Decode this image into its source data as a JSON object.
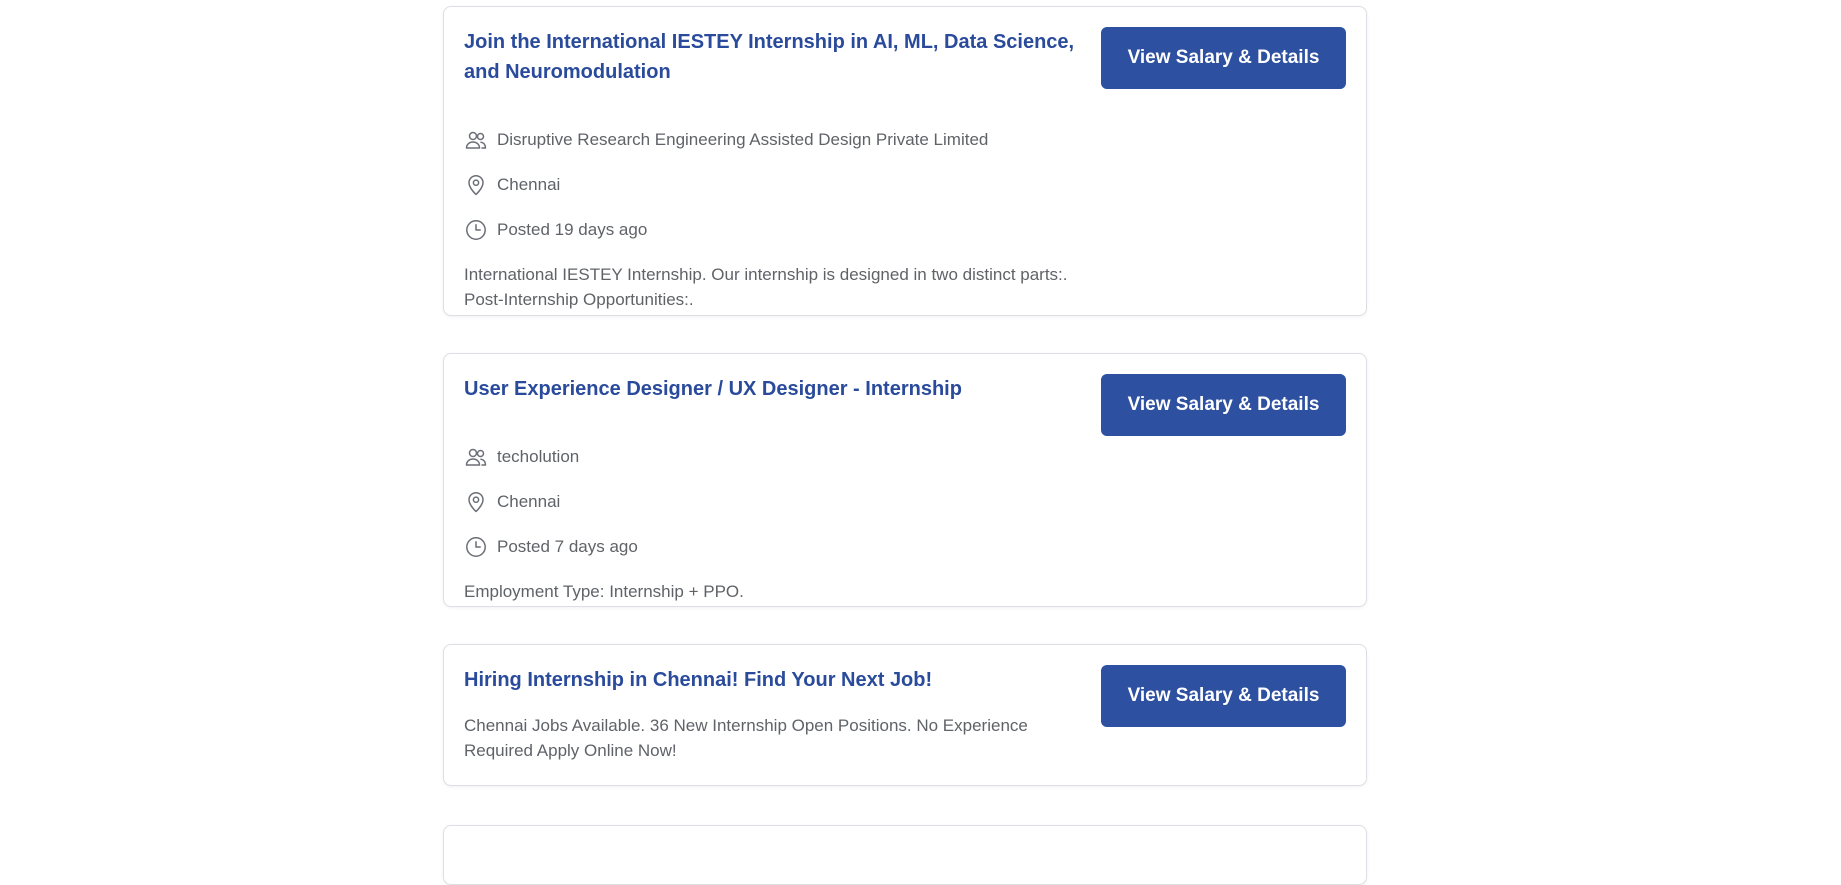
{
  "jobs": [
    {
      "title": "Join the International IESTEY Internship in AI, ML, Data Science, and Neuromodulation",
      "company": "Disruptive Research Engineering Assisted Design Private Limited",
      "location": "Chennai",
      "posted": "Posted 19 days ago",
      "description": "International IESTEY Internship. Our internship is designed in two distinct parts:. Post-Internship Opportunities:.",
      "button": "View Salary & Details"
    },
    {
      "title": "User Experience Designer / UX Designer - Internship",
      "company": "techolution",
      "location": "Chennai",
      "posted": "Posted 7 days ago",
      "description": "Employment Type: Internship + PPO.",
      "button": "View Salary & Details"
    },
    {
      "title": "Hiring Internship in Chennai! Find Your Next Job!",
      "description": "Chennai Jobs Available. 36 New Internship Open Positions. No Experience Required Apply Online Now!",
      "button": "View Salary & Details"
    }
  ],
  "colors": {
    "title": "#2a4b9b",
    "button_bg": "#2d50a0",
    "meta_text": "#5f6368",
    "border": "#dcdfe4"
  },
  "icons": {
    "company": "users-icon",
    "location": "map-pin-icon",
    "posted": "clock-icon"
  }
}
